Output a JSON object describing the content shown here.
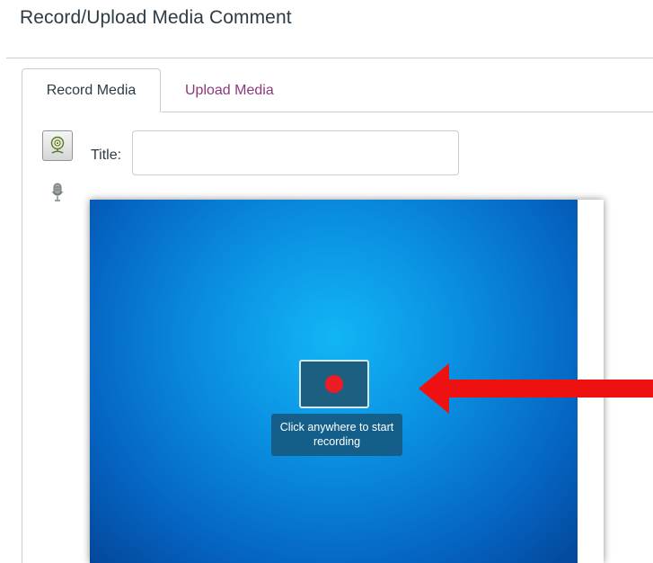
{
  "dialog": {
    "title": "Record/Upload Media Comment"
  },
  "tabs": [
    {
      "label": "Record Media",
      "active": true
    },
    {
      "label": "Upload Media",
      "active": false
    }
  ],
  "form": {
    "title_label": "Title:",
    "title_value": "",
    "title_placeholder": ""
  },
  "recorder": {
    "hint": "Click anywhere to start recording"
  },
  "icons": {
    "webcam": "webcam-icon",
    "microphone": "microphone-icon",
    "record": "record-icon",
    "annotation": "arrow-left-icon"
  },
  "colors": {
    "tab_inactive": "#8b3a7e",
    "record_dot": "#ec1c24",
    "stage_blue": "#0a8ee0",
    "annotation_arrow": "#ee1111"
  }
}
